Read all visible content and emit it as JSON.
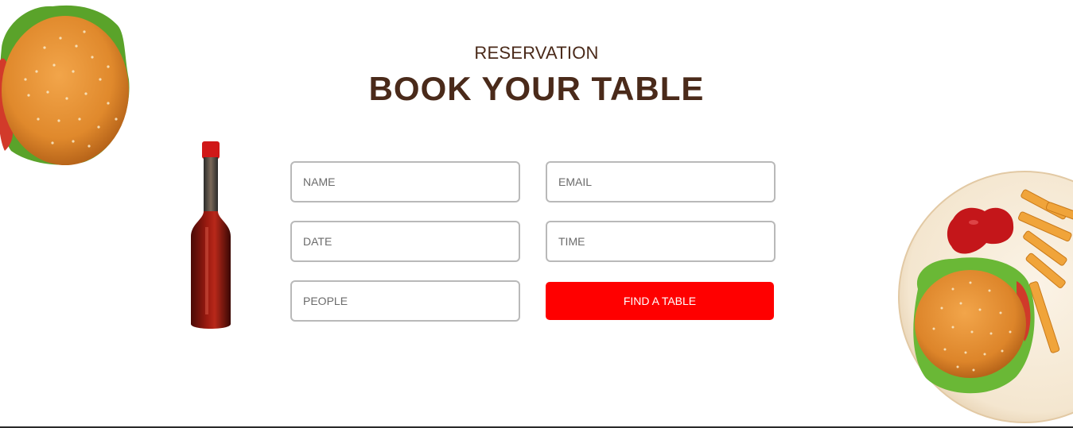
{
  "section": {
    "subtitle": "RESERVATION",
    "title": "BOOK YOUR TABLE"
  },
  "form": {
    "name_placeholder": "NAME",
    "email_placeholder": "EMAIL",
    "date_placeholder": "DATE",
    "time_placeholder": "TIME",
    "people_placeholder": "PEOPLE",
    "submit_label": "FIND A TABLE"
  },
  "colors": {
    "heading": "#4a2a1a",
    "accent": "#ff0000",
    "input_border": "#b9b9b9"
  },
  "images": {
    "top_left": "burger-image",
    "left_of_form": "hot-sauce-bottle-image",
    "right": "burger-fries-plate-image"
  }
}
